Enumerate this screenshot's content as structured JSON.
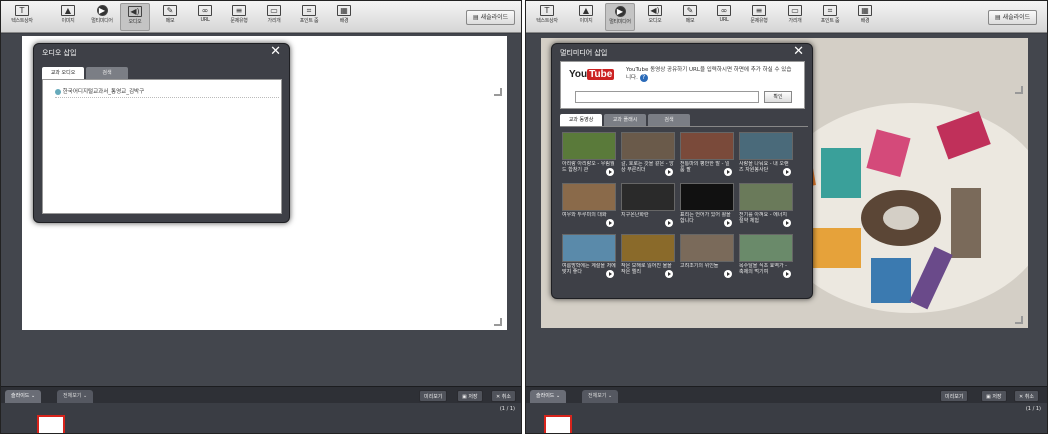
{
  "toolbar": {
    "items": [
      {
        "label": "텍스트상자",
        "icon": "text-box-icon"
      },
      {
        "label": "이미지",
        "icon": "image-icon"
      },
      {
        "label": "멀티미디어",
        "icon": "multimedia-icon"
      },
      {
        "label": "오디오",
        "icon": "audio-icon"
      },
      {
        "label": "메모",
        "icon": "memo-icon"
      },
      {
        "label": "URL",
        "icon": "url-icon"
      },
      {
        "label": "문제유형",
        "icon": "question-type-icon"
      },
      {
        "label": "가리개",
        "icon": "cover-icon"
      },
      {
        "label": "포인트 줌",
        "icon": "point-zoom-icon"
      },
      {
        "label": "배경",
        "icon": "background-icon"
      }
    ],
    "new_slide_label": "새슬라이드"
  },
  "left_dialog": {
    "title": "오디오 삽입",
    "close": "✕",
    "tabs": [
      "교과 오디오",
      "검색"
    ],
    "file_item": "한국어디지털교과서_통영교_김박구"
  },
  "right_dialog": {
    "title": "멀티미디어 삽입",
    "close": "✕",
    "youtube_logo_you": "You",
    "youtube_logo_tube": "Tube",
    "youtube_desc": "YouTube 동영상 공유하기 URL을 입력하시면 하면에 추가 하실 수 있습니다.",
    "help": "?",
    "confirm_label": "확인",
    "tabs": [
      "교과 동영상",
      "교과 플래시",
      "검색"
    ],
    "videos": [
      {
        "title": "아리랑 아리랑오 - 우림월드 합창기 관",
        "color": "#5a7a3a"
      },
      {
        "title": "갈, 호로는 갓을 같은 - 앙상 푸른리더",
        "color": "#6a5a4a"
      },
      {
        "title": "전통마의 평안한 말 - 일품 팔",
        "color": "#7a4a3a"
      },
      {
        "title": "사랑을 나눠요 - 내 오랜즈 자원봉사단",
        "color": "#4a6a7a"
      },
      {
        "title": "여우와 두루미의 대화",
        "color": "#8a6a4a"
      },
      {
        "title": "지구온난화란",
        "color": "#2a2a2a"
      },
      {
        "title": "표리는 언어가 있어 활을 합니다",
        "color": "#111111"
      },
      {
        "title": "전기를 아껴요 - 에너지 절약 체험",
        "color": "#6a7a5a"
      },
      {
        "title": "여름방학에는 계절을 저에 맞지 좋다",
        "color": "#5a8aaa"
      },
      {
        "title": "작은 모해로 잃어진 울을 작은 엘리",
        "color": "#8a6a2a"
      },
      {
        "title": "고려조기의 위인들",
        "color": "#7a6a5a"
      },
      {
        "title": "목수탈을 식초 효역가 - 축제의 먹기여",
        "color": "#6a8a6a"
      }
    ]
  },
  "bottom": {
    "slide_tab": "슬라이드",
    "all_view_tab": "전체보기",
    "preview_label": "미리보기",
    "save_label": "저장",
    "cancel_label": "취소",
    "page_count": "(1 / 1)"
  },
  "right_bottom": {
    "preview_label": "미리보기",
    "save_label": "저장",
    "cancel_label": "취소",
    "page_count": "(1 / 1)"
  },
  "colors": {
    "accent_red": "#d8241c",
    "youtube_red": "#cc2222"
  }
}
